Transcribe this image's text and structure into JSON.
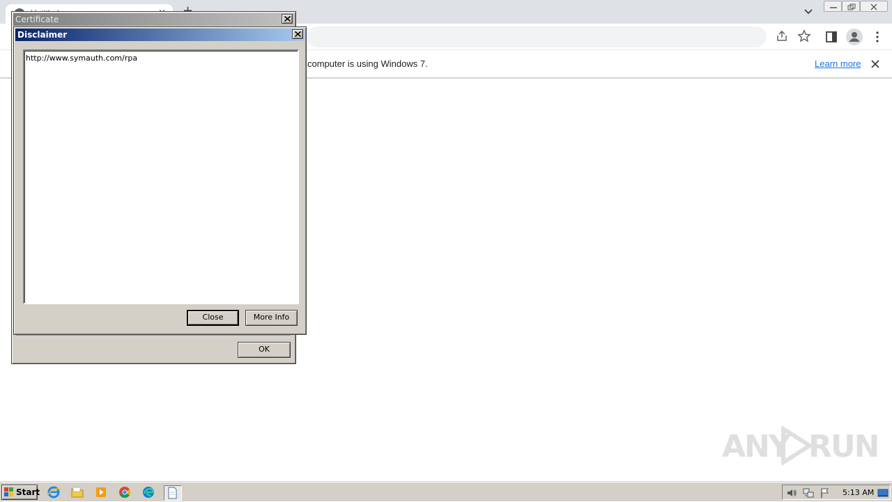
{
  "browser": {
    "tab_title": "Untitled",
    "tab_close": "×",
    "new_tab": "+",
    "infobar": {
      "message": "computer is using Windows 7.",
      "learn_more": "Learn more"
    }
  },
  "certificate_dialog": {
    "title": "Certificate",
    "ok_label": "OK"
  },
  "disclaimer_dialog": {
    "title": "Disclaimer",
    "content": "http://www.symauth.com/rpa",
    "close_label": "Close",
    "more_info_label": "More Info"
  },
  "watermark": {
    "left": "ANY",
    "right": "RUN"
  },
  "taskbar": {
    "start_label": "Start",
    "clock": "5:13 AM",
    "apps": [
      "internet-explorer-icon",
      "folder-icon",
      "media-player-icon",
      "chrome-icon",
      "edge-icon",
      "notepad-icon"
    ]
  },
  "colors": {
    "dialog_face": "#d4d0c8",
    "active_title_start": "#0a246a",
    "active_title_end": "#a6caf0",
    "link_blue": "#1a73e8"
  }
}
